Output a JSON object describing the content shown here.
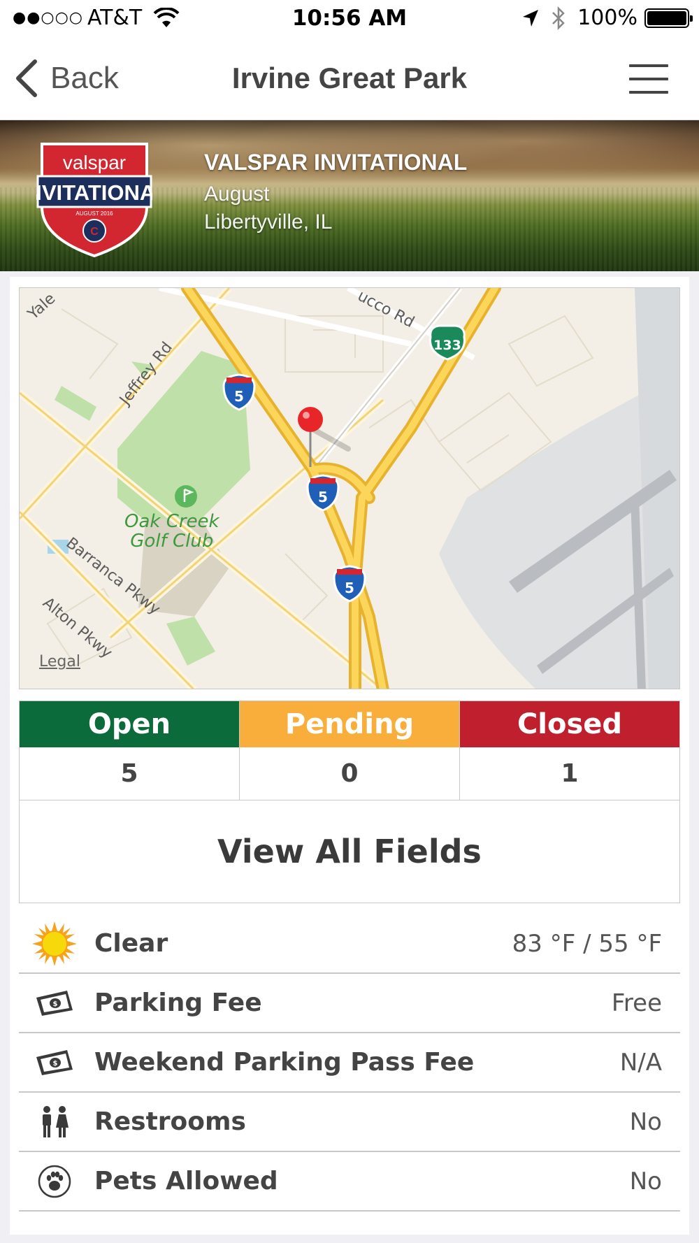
{
  "status_bar": {
    "signal_dots": "●●○○○",
    "carrier": "AT&T",
    "time": "10:56 AM",
    "battery": "100%"
  },
  "nav": {
    "back_label": "Back",
    "title": "Irvine Great Park"
  },
  "banner": {
    "event_name": "VALSPAR INVITATIONAL",
    "logo_brand": "valspar",
    "logo_text": "INVITATIONAL",
    "logo_subtext": "AUGUST 2016",
    "month": "August",
    "location": "Libertyville, IL"
  },
  "map": {
    "labels": {
      "yale": "Yale",
      "ucco_rd": "ucco Rd",
      "jeffrey_rd": "Jeffrey Rd",
      "barranca_pkwy": "Barranca Pkwy",
      "alton_pkwy": "Alton Pkwy",
      "golf_line1": "Oak Creek",
      "golf_line2": "Golf Club",
      "route_133": "133",
      "route_5": "5",
      "legal": "Legal"
    }
  },
  "field_status": [
    {
      "label": "Open",
      "count": "5",
      "color": "#0b6b3a"
    },
    {
      "label": "Pending",
      "count": "0",
      "color": "#f9ae3b"
    },
    {
      "label": "Closed",
      "count": "1",
      "color": "#c0202e"
    }
  ],
  "view_all_label": "View All Fields",
  "info": [
    {
      "icon": "sun-icon",
      "label": "Clear",
      "value": "83 °F / 55 °F"
    },
    {
      "icon": "money-icon",
      "label": "Parking Fee",
      "value": "Free"
    },
    {
      "icon": "money-icon",
      "label": "Weekend Parking Pass Fee",
      "value": "N/A"
    },
    {
      "icon": "restroom-icon",
      "label": "Restrooms",
      "value": "No"
    },
    {
      "icon": "paw-icon",
      "label": "Pets Allowed",
      "value": "No"
    }
  ]
}
